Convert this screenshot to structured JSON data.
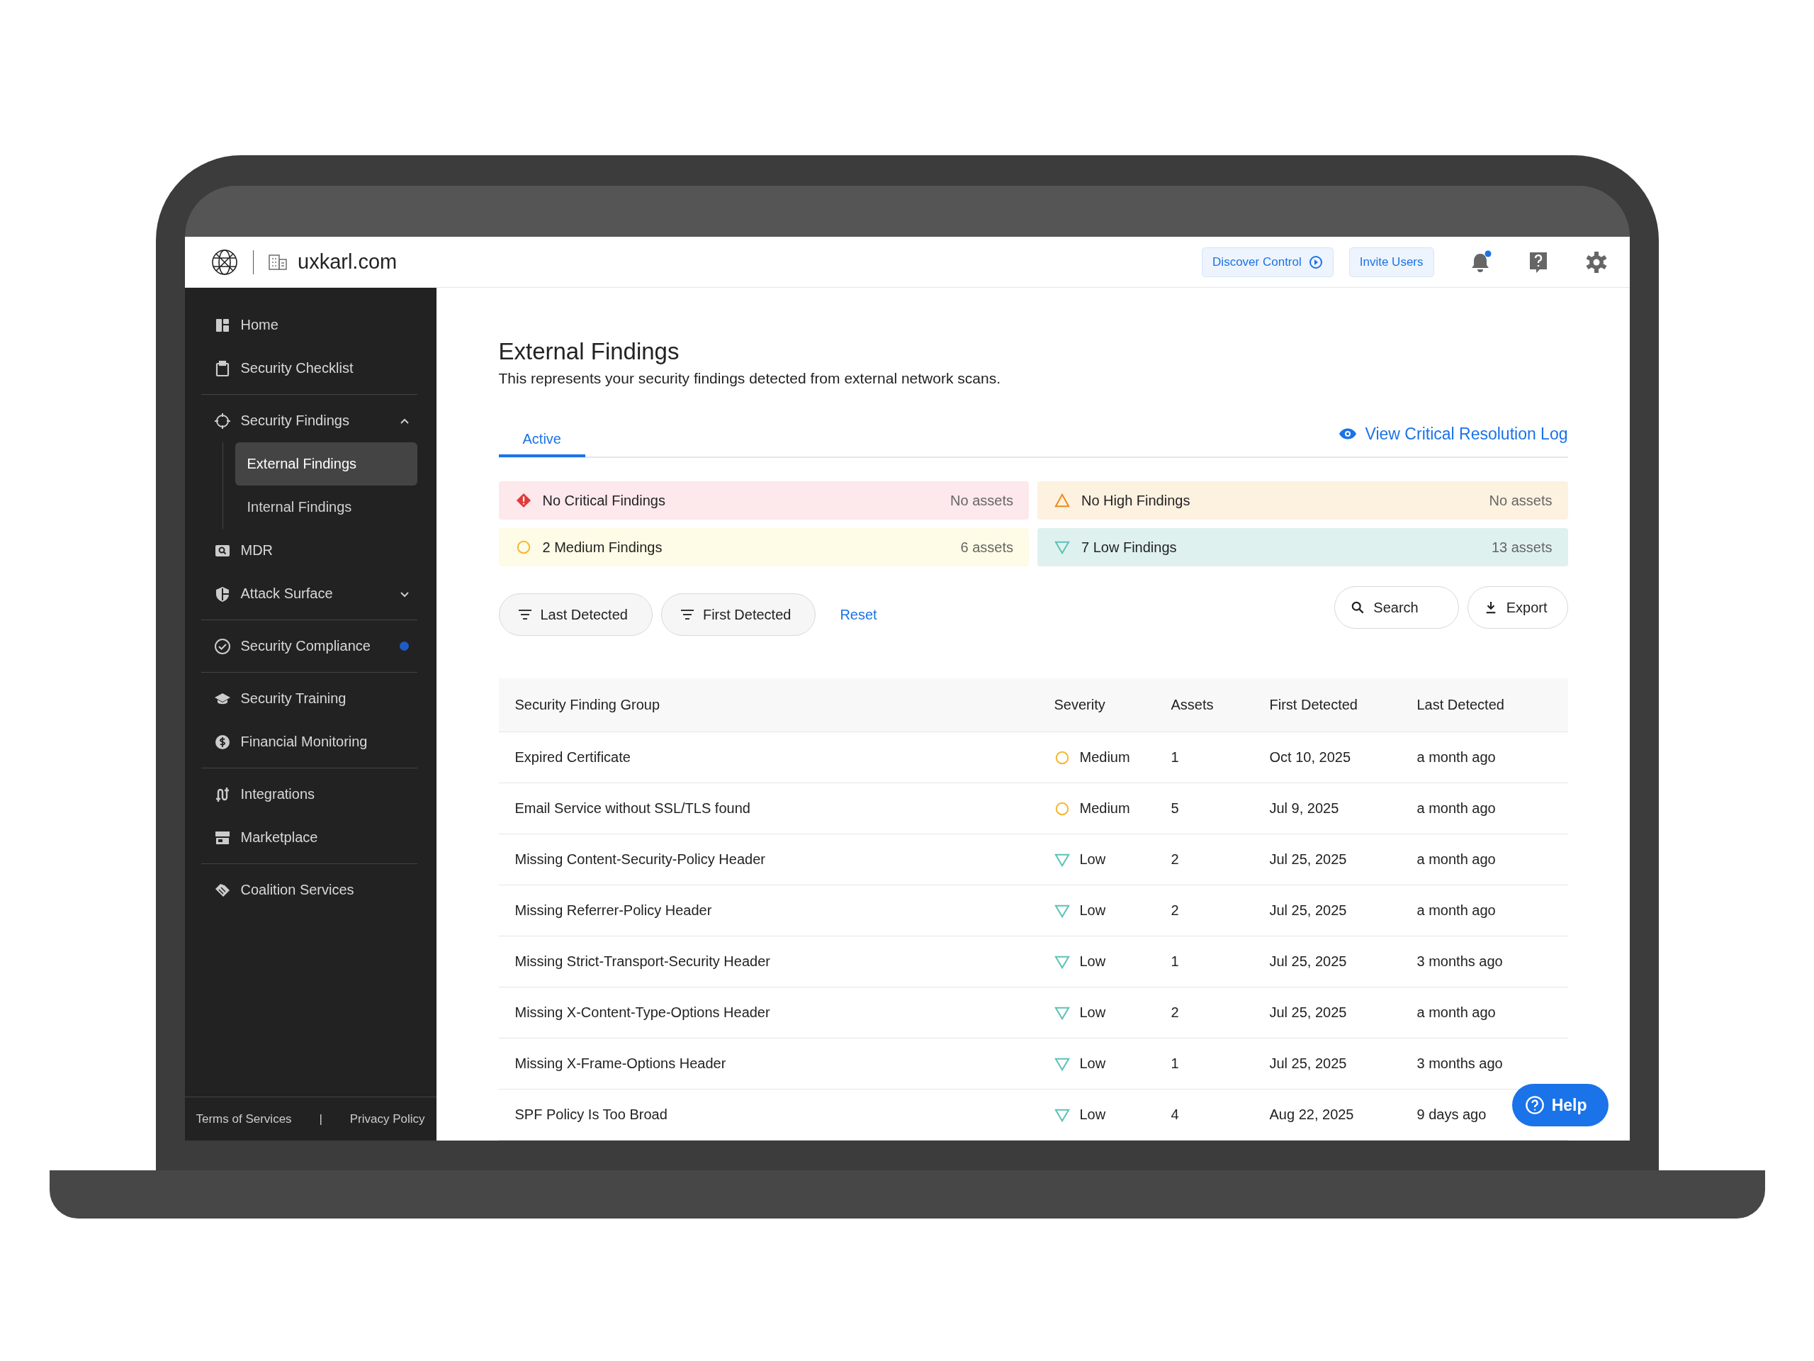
{
  "topbar": {
    "domain": "uxkarl.com",
    "buttons": [
      {
        "label": "Discover Control",
        "kind": "play"
      },
      {
        "label": "Invite Users",
        "kind": "plain"
      }
    ],
    "notifications_unread": true
  },
  "sidebar": {
    "groups": [
      {
        "items": [
          {
            "label": "Home"
          },
          {
            "label": "Security Checklist"
          }
        ]
      },
      {
        "items": [
          {
            "label": "Security Findings",
            "expanded": true,
            "children": [
              {
                "label": "External Findings",
                "selected": true
              },
              {
                "label": "Internal Findings",
                "selected": false
              }
            ]
          },
          {
            "label": "MDR"
          },
          {
            "label": "Attack Surface",
            "expanded": false
          }
        ]
      },
      {
        "items": [
          {
            "label": "Security Compliance",
            "dot": true
          }
        ]
      },
      {
        "items": [
          {
            "label": "Security Training"
          },
          {
            "label": "Financial Monitoring"
          }
        ]
      },
      {
        "items": [
          {
            "label": "Integrations"
          },
          {
            "label": "Marketplace"
          }
        ]
      },
      {
        "items": [
          {
            "label": "Coalition Services"
          }
        ]
      }
    ],
    "footer_links": [
      "Terms of Services",
      "Privacy Policy"
    ],
    "footer_separator": "|"
  },
  "page": {
    "title": "External Findings",
    "subtitle": "This represents your security findings detected from external network scans."
  },
  "tabs": [
    {
      "label": "Active",
      "selected": true
    }
  ],
  "resolution_log_link": "View Critical Resolution Log",
  "summary": [
    {
      "kind": "critical",
      "label": "No Critical Findings",
      "assets": "No assets"
    },
    {
      "kind": "high",
      "label": "No High Findings",
      "assets": "No assets"
    },
    {
      "kind": "medium",
      "label": "2 Medium Findings",
      "assets": "6 assets"
    },
    {
      "kind": "low",
      "label": "7 Low Findings",
      "assets": "13 assets"
    }
  ],
  "filters": [
    "Last Detected",
    "First Detected"
  ],
  "reset": "Reset",
  "search": {
    "label": "Search"
  },
  "export": "Export",
  "table": {
    "columns": [
      "Security Finding Group",
      "Severity",
      "Assets",
      "First Detected",
      "Last Detected"
    ],
    "rows": [
      {
        "group": "Expired Certificate",
        "kind": "medium",
        "severity": "Medium",
        "assets": "1",
        "first": "Oct 10, 2025",
        "last": "a month ago"
      },
      {
        "group": "Email Service without SSL/TLS found",
        "kind": "medium",
        "severity": "Medium",
        "assets": "5",
        "first": "Jul 9, 2025",
        "last": "a month ago"
      },
      {
        "group": "Missing Content-Security-Policy Header",
        "kind": "low",
        "severity": "Low",
        "assets": "2",
        "first": "Jul 25, 2025",
        "last": "a month ago"
      },
      {
        "group": "Missing Referrer-Policy Header",
        "kind": "low",
        "severity": "Low",
        "assets": "2",
        "first": "Jul 25, 2025",
        "last": "a month ago"
      },
      {
        "group": "Missing Strict-Transport-Security Header",
        "kind": "low",
        "severity": "Low",
        "assets": "1",
        "first": "Jul 25, 2025",
        "last": "3 months ago"
      },
      {
        "group": "Missing X-Content-Type-Options Header",
        "kind": "low",
        "severity": "Low",
        "assets": "2",
        "first": "Jul 25, 2025",
        "last": "a month ago"
      },
      {
        "group": "Missing X-Frame-Options Header",
        "kind": "low",
        "severity": "Low",
        "assets": "1",
        "first": "Jul 25, 2025",
        "last": "3 months ago"
      },
      {
        "group": "SPF Policy Is Too Broad",
        "kind": "low",
        "severity": "Low",
        "assets": "4",
        "first": "Aug 22, 2025",
        "last": "9 days ago"
      }
    ]
  },
  "help_button": "Help"
}
